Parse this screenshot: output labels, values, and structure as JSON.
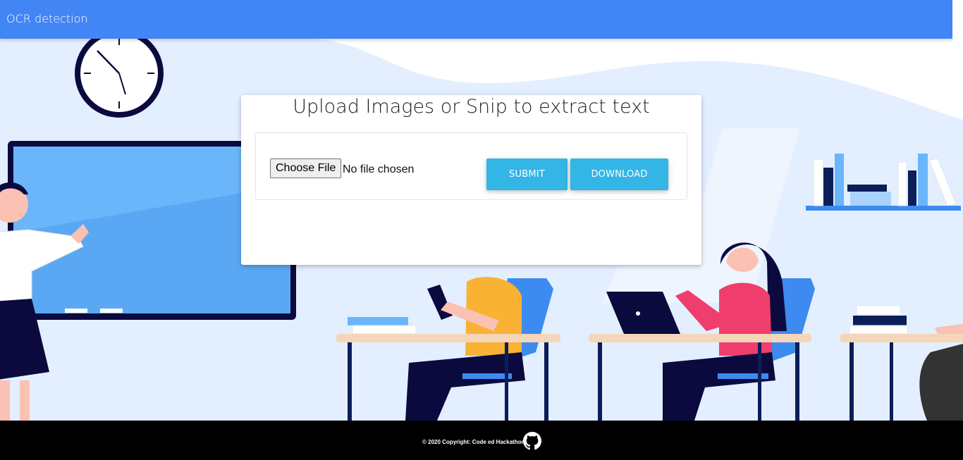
{
  "navbar": {
    "brand": "OCR detection"
  },
  "card": {
    "title": "Upload Images or Snip to extract text",
    "file_input": {
      "button_label": "Choose File",
      "status": "No file chosen"
    },
    "submit_label": "SUBMIT",
    "download_label": "DOWNLOAD"
  },
  "footer": {
    "copyright": "© 2020 Copyright: Code ed Hackathon",
    "github_icon": "github-icon"
  },
  "colors": {
    "navbar": "#4285f4",
    "button": "#33b5e5",
    "footer": "#000000",
    "background": "#e3efff"
  }
}
